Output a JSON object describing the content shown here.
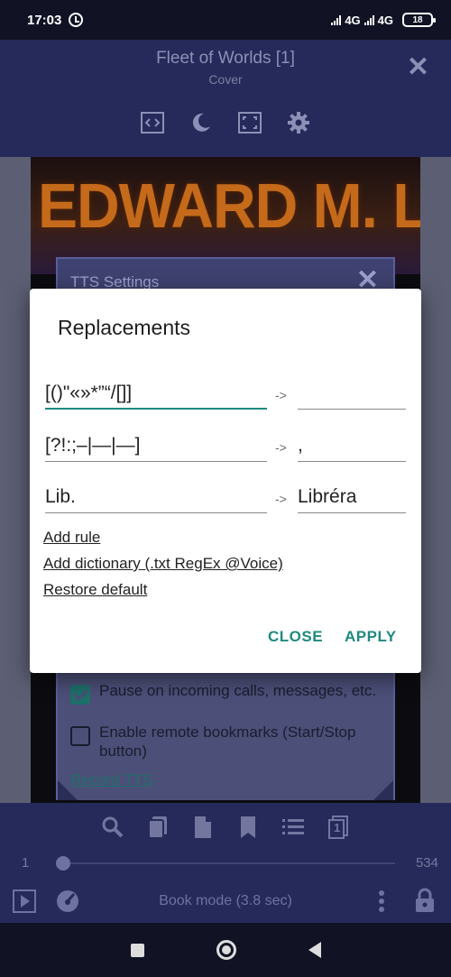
{
  "status_bar": {
    "time": "17:03",
    "network_1": "4G",
    "network_2": "4G",
    "battery": "18"
  },
  "header": {
    "title": "Fleet of Worlds [1]",
    "subtitle": "Cover"
  },
  "cover": {
    "author": "EDWARD M. LERNER"
  },
  "tts_panel": {
    "title": "TTS Settings",
    "options": [
      {
        "label": "Pause on incoming calls, messages, etc.",
        "checked": true
      },
      {
        "label": "Enable remote bookmarks (Start/Stop button)",
        "checked": false
      }
    ],
    "record_link": "Record TTS"
  },
  "dialog": {
    "title": "Replacements",
    "rules": [
      {
        "from": "[()\"«»*”“/[]]",
        "arrow": "->",
        "to": ""
      },
      {
        "from": "[?!:;–|—|―]",
        "arrow": "->",
        "to": ","
      },
      {
        "from": "Lib.",
        "arrow": "->",
        "to": "Libréra"
      }
    ],
    "links": {
      "add_rule": "Add rule",
      "add_dictionary": "Add dictionary (.txt RegEx @Voice)",
      "restore_default": "Restore default"
    },
    "buttons": {
      "close": "CLOSE",
      "apply": "APPLY"
    }
  },
  "bottom_bar": {
    "page_min": "1",
    "page_max": "534",
    "mode_text": "Book mode (3.8 sec)",
    "page_icon_number": "1"
  },
  "colors": {
    "accent": "#1e8a80",
    "toolbar": "#262a5a",
    "panel": "#3f4270"
  }
}
